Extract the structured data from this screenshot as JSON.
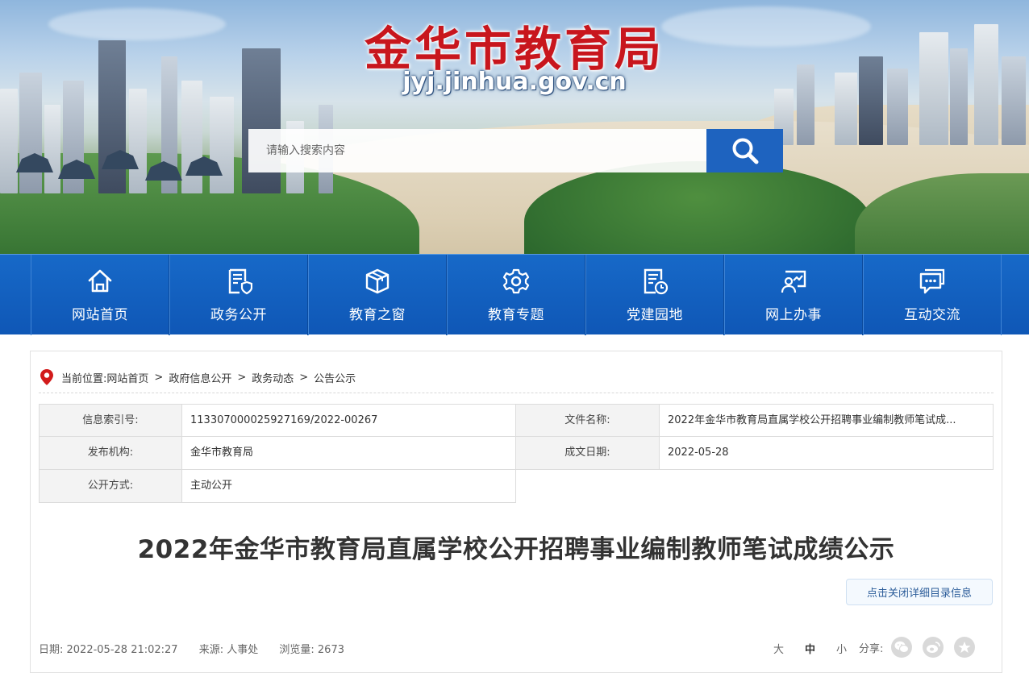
{
  "header": {
    "site_title": "金华市教育局",
    "site_url": "jyj.jinhua.gov.cn",
    "search_placeholder": "请输入搜索内容",
    "search_icon": "search-icon"
  },
  "nav": {
    "items": [
      {
        "label": "网站首页",
        "icon": "home-icon"
      },
      {
        "label": "政务公开",
        "icon": "document-shield-icon"
      },
      {
        "label": "教育之窗",
        "icon": "cube-icon"
      },
      {
        "label": "教育专题",
        "icon": "gear-icon"
      },
      {
        "label": "党建园地",
        "icon": "document-clock-icon"
      },
      {
        "label": "网上办事",
        "icon": "person-chart-icon"
      },
      {
        "label": "互动交流",
        "icon": "chat-icon"
      }
    ]
  },
  "breadcrumb": {
    "prefix": "当前位置:",
    "items": [
      "网站首页",
      "政府信息公开",
      "政务动态",
      "公告公示"
    ],
    "separator": ">"
  },
  "meta": {
    "index_label": "信息索引号:",
    "index_value": "113307000025927169/2022-00267",
    "filename_label": "文件名称:",
    "filename_value": "2022年金华市教育局直属学校公开招聘事业编制教师笔试成...",
    "publisher_label": "发布机构:",
    "publisher_value": "金华市教育局",
    "date_label": "成文日期:",
    "date_value": "2022-05-28",
    "mode_label": "公开方式:",
    "mode_value": "主动公开"
  },
  "article": {
    "title": "2022年金华市教育局直属学校公开招聘事业编制教师笔试成绩公示",
    "toggle_label": "点击关闭详细目录信息",
    "date_text": "日期: 2022-05-28 21:02:27",
    "source_text": "来源: 人事处",
    "views_text": "浏览量: 2673"
  },
  "tools": {
    "font_large": "大",
    "font_medium": "中",
    "font_small": "小",
    "share_label": "分享:",
    "share_icons": [
      "wechat-icon",
      "weibo-icon",
      "star-icon"
    ]
  },
  "colors": {
    "brand_red": "#c8161d",
    "nav_blue": "#1769c8",
    "search_blue": "#1e63bf"
  }
}
